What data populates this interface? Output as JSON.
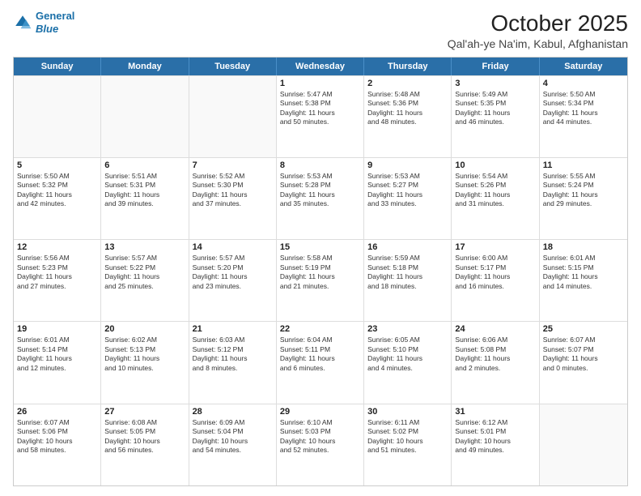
{
  "header": {
    "logo_line1": "General",
    "logo_line2": "Blue",
    "title": "October 2025",
    "subtitle": "Qal'ah-ye Na'im, Kabul, Afghanistan"
  },
  "weekdays": [
    "Sunday",
    "Monday",
    "Tuesday",
    "Wednesday",
    "Thursday",
    "Friday",
    "Saturday"
  ],
  "weeks": [
    [
      {
        "day": "",
        "info": ""
      },
      {
        "day": "",
        "info": ""
      },
      {
        "day": "",
        "info": ""
      },
      {
        "day": "1",
        "info": "Sunrise: 5:47 AM\nSunset: 5:38 PM\nDaylight: 11 hours\nand 50 minutes."
      },
      {
        "day": "2",
        "info": "Sunrise: 5:48 AM\nSunset: 5:36 PM\nDaylight: 11 hours\nand 48 minutes."
      },
      {
        "day": "3",
        "info": "Sunrise: 5:49 AM\nSunset: 5:35 PM\nDaylight: 11 hours\nand 46 minutes."
      },
      {
        "day": "4",
        "info": "Sunrise: 5:50 AM\nSunset: 5:34 PM\nDaylight: 11 hours\nand 44 minutes."
      }
    ],
    [
      {
        "day": "5",
        "info": "Sunrise: 5:50 AM\nSunset: 5:32 PM\nDaylight: 11 hours\nand 42 minutes."
      },
      {
        "day": "6",
        "info": "Sunrise: 5:51 AM\nSunset: 5:31 PM\nDaylight: 11 hours\nand 39 minutes."
      },
      {
        "day": "7",
        "info": "Sunrise: 5:52 AM\nSunset: 5:30 PM\nDaylight: 11 hours\nand 37 minutes."
      },
      {
        "day": "8",
        "info": "Sunrise: 5:53 AM\nSunset: 5:28 PM\nDaylight: 11 hours\nand 35 minutes."
      },
      {
        "day": "9",
        "info": "Sunrise: 5:53 AM\nSunset: 5:27 PM\nDaylight: 11 hours\nand 33 minutes."
      },
      {
        "day": "10",
        "info": "Sunrise: 5:54 AM\nSunset: 5:26 PM\nDaylight: 11 hours\nand 31 minutes."
      },
      {
        "day": "11",
        "info": "Sunrise: 5:55 AM\nSunset: 5:24 PM\nDaylight: 11 hours\nand 29 minutes."
      }
    ],
    [
      {
        "day": "12",
        "info": "Sunrise: 5:56 AM\nSunset: 5:23 PM\nDaylight: 11 hours\nand 27 minutes."
      },
      {
        "day": "13",
        "info": "Sunrise: 5:57 AM\nSunset: 5:22 PM\nDaylight: 11 hours\nand 25 minutes."
      },
      {
        "day": "14",
        "info": "Sunrise: 5:57 AM\nSunset: 5:20 PM\nDaylight: 11 hours\nand 23 minutes."
      },
      {
        "day": "15",
        "info": "Sunrise: 5:58 AM\nSunset: 5:19 PM\nDaylight: 11 hours\nand 21 minutes."
      },
      {
        "day": "16",
        "info": "Sunrise: 5:59 AM\nSunset: 5:18 PM\nDaylight: 11 hours\nand 18 minutes."
      },
      {
        "day": "17",
        "info": "Sunrise: 6:00 AM\nSunset: 5:17 PM\nDaylight: 11 hours\nand 16 minutes."
      },
      {
        "day": "18",
        "info": "Sunrise: 6:01 AM\nSunset: 5:15 PM\nDaylight: 11 hours\nand 14 minutes."
      }
    ],
    [
      {
        "day": "19",
        "info": "Sunrise: 6:01 AM\nSunset: 5:14 PM\nDaylight: 11 hours\nand 12 minutes."
      },
      {
        "day": "20",
        "info": "Sunrise: 6:02 AM\nSunset: 5:13 PM\nDaylight: 11 hours\nand 10 minutes."
      },
      {
        "day": "21",
        "info": "Sunrise: 6:03 AM\nSunset: 5:12 PM\nDaylight: 11 hours\nand 8 minutes."
      },
      {
        "day": "22",
        "info": "Sunrise: 6:04 AM\nSunset: 5:11 PM\nDaylight: 11 hours\nand 6 minutes."
      },
      {
        "day": "23",
        "info": "Sunrise: 6:05 AM\nSunset: 5:10 PM\nDaylight: 11 hours\nand 4 minutes."
      },
      {
        "day": "24",
        "info": "Sunrise: 6:06 AM\nSunset: 5:08 PM\nDaylight: 11 hours\nand 2 minutes."
      },
      {
        "day": "25",
        "info": "Sunrise: 6:07 AM\nSunset: 5:07 PM\nDaylight: 11 hours\nand 0 minutes."
      }
    ],
    [
      {
        "day": "26",
        "info": "Sunrise: 6:07 AM\nSunset: 5:06 PM\nDaylight: 10 hours\nand 58 minutes."
      },
      {
        "day": "27",
        "info": "Sunrise: 6:08 AM\nSunset: 5:05 PM\nDaylight: 10 hours\nand 56 minutes."
      },
      {
        "day": "28",
        "info": "Sunrise: 6:09 AM\nSunset: 5:04 PM\nDaylight: 10 hours\nand 54 minutes."
      },
      {
        "day": "29",
        "info": "Sunrise: 6:10 AM\nSunset: 5:03 PM\nDaylight: 10 hours\nand 52 minutes."
      },
      {
        "day": "30",
        "info": "Sunrise: 6:11 AM\nSunset: 5:02 PM\nDaylight: 10 hours\nand 51 minutes."
      },
      {
        "day": "31",
        "info": "Sunrise: 6:12 AM\nSunset: 5:01 PM\nDaylight: 10 hours\nand 49 minutes."
      },
      {
        "day": "",
        "info": ""
      }
    ]
  ]
}
